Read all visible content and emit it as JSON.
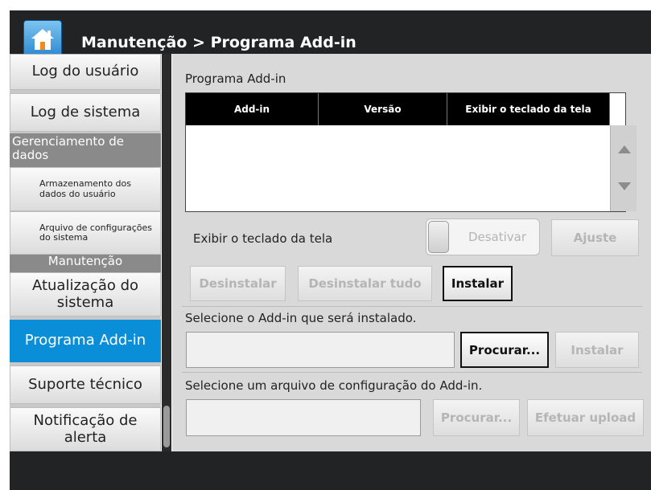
{
  "header": {
    "title": "Manutenção > Programa Add-in"
  },
  "sidebar": {
    "items": [
      {
        "kind": "button",
        "label": "Log do usuário"
      },
      {
        "kind": "button",
        "label": "Log de sistema"
      },
      {
        "kind": "header",
        "label": "Gerenciamento de dados"
      },
      {
        "kind": "sub",
        "label": "Armazenamento dos dados do usuário"
      },
      {
        "kind": "sub",
        "label": "Arquivo de configurações do sistema"
      },
      {
        "kind": "header",
        "label": "Manutenção"
      },
      {
        "kind": "button",
        "label": "Atualização do sistema"
      },
      {
        "kind": "button",
        "label": "Programa Add-in",
        "active": true
      },
      {
        "kind": "button",
        "label": "Suporte técnico"
      },
      {
        "kind": "button",
        "label": "Notificação de alerta"
      }
    ]
  },
  "main": {
    "section_title": "Programa Add-in",
    "table": {
      "columns": [
        "Add-in",
        "Versão",
        "Exibir o teclado da tela"
      ],
      "rows": []
    },
    "keyboard_label": "Exibir o teclado da tela",
    "toggle_label": "Desativar",
    "adjust_label": "Ajuste",
    "uninstall_label": "Desinstalar",
    "uninstall_all_label": "Desinstalar tudo",
    "install_label": "Instalar",
    "select_addin_label": "Selecione o Add-in que será instalado.",
    "browse_label": "Procurar...",
    "install2_label": "Instalar",
    "select_config_label": "Selecione um arquivo de configuração do Add-in.",
    "browse2_label": "Procurar...",
    "upload_label": "Efetuar upload",
    "addin_path_value": "",
    "config_path_value": ""
  },
  "colors": {
    "titlebar": "#222325",
    "active_item": "#0b8ed8",
    "panel": "#d9d9d9"
  },
  "icons": {
    "home": "home-icon",
    "up": "arrow-up-icon",
    "down": "arrow-down-icon"
  }
}
